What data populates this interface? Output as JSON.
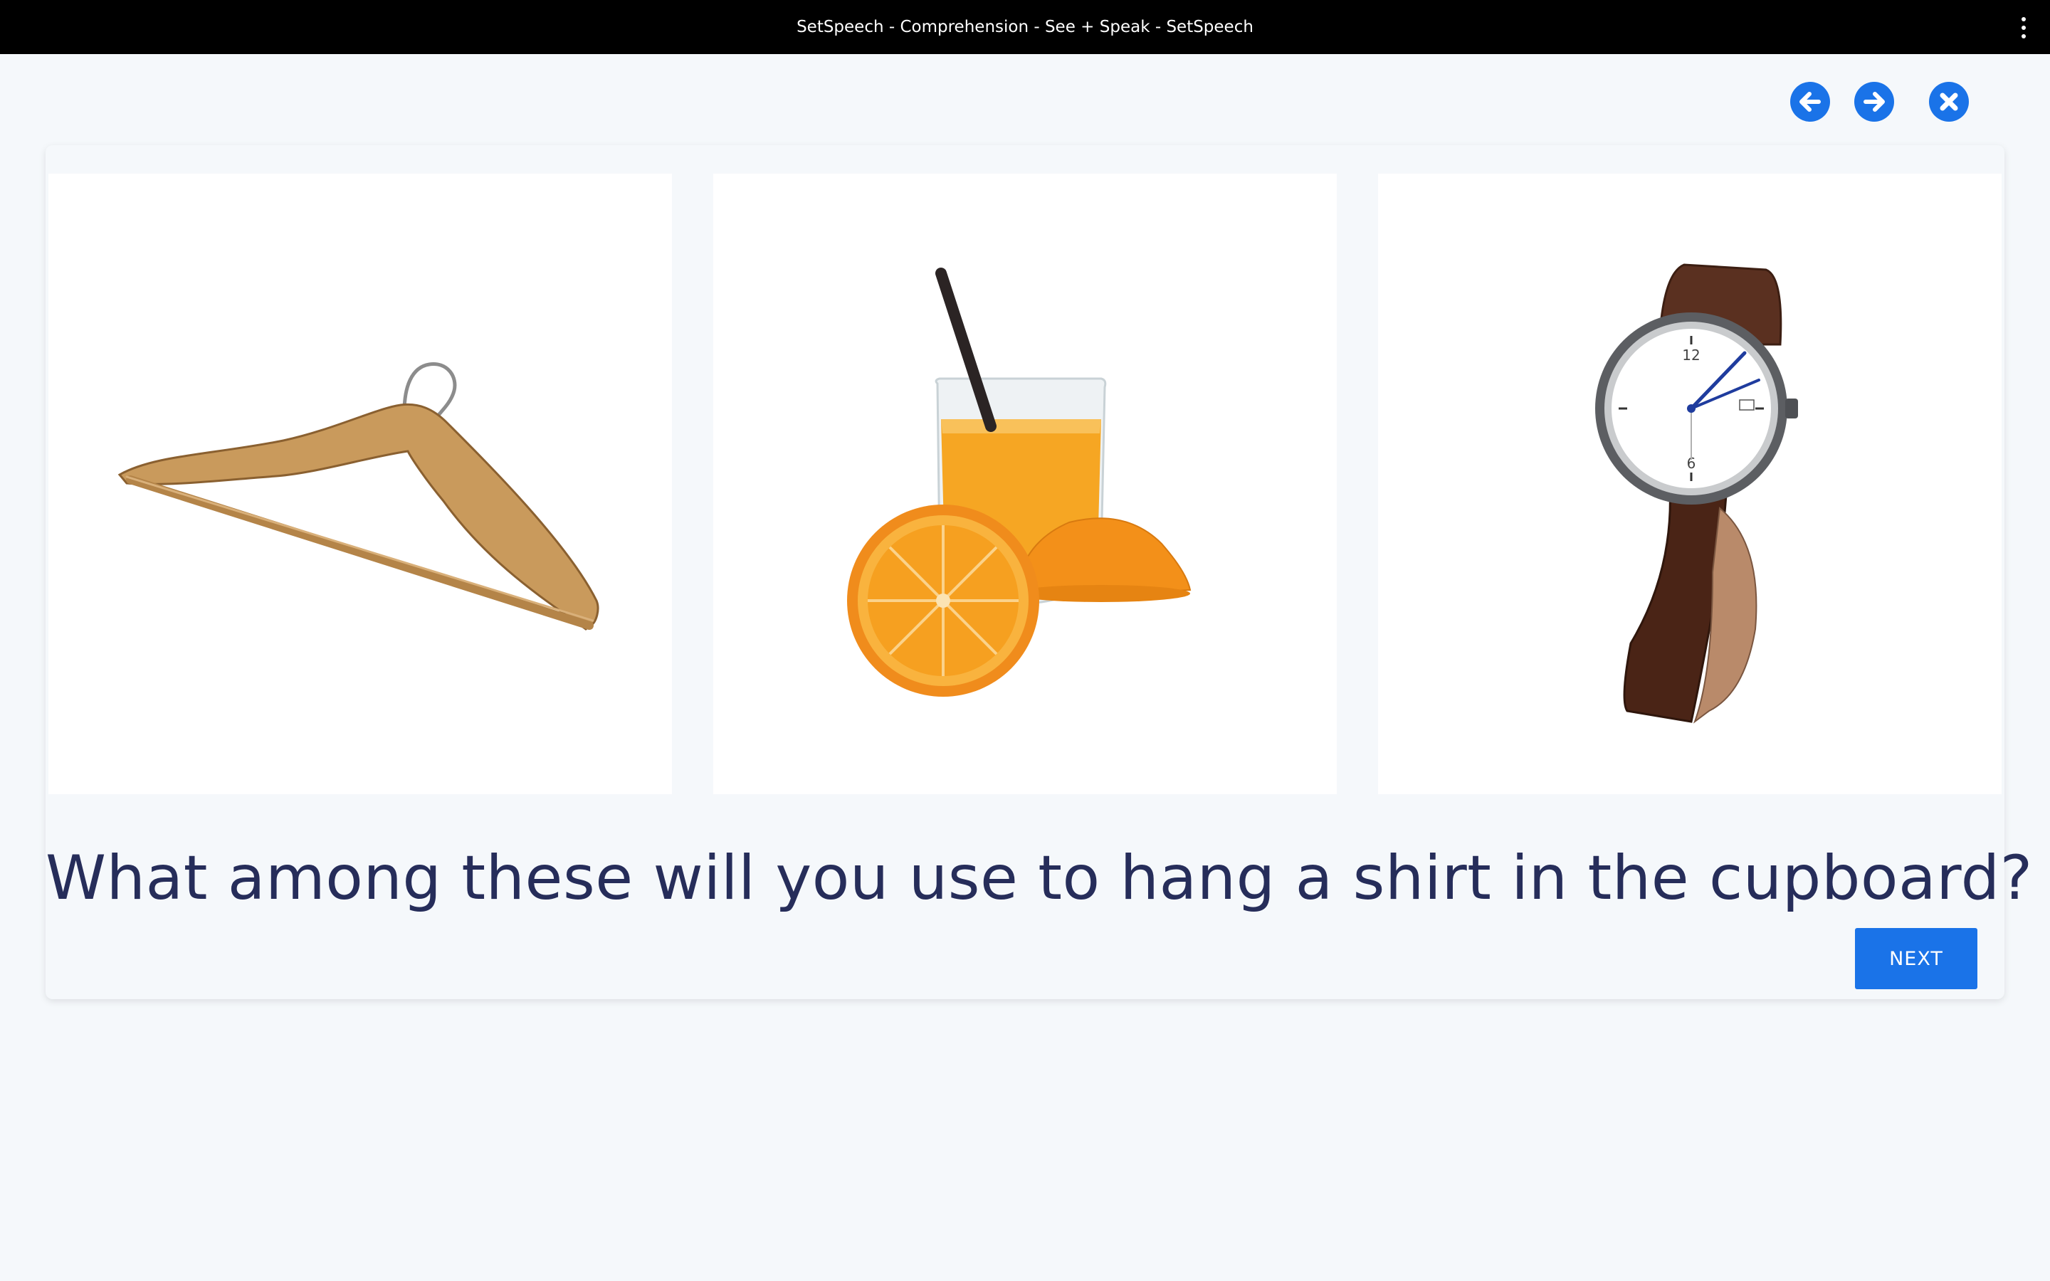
{
  "window": {
    "title": "SetSpeech - Comprehension - See + Speak - SetSpeech"
  },
  "icons": {
    "prev": "arrow-left-icon",
    "next": "arrow-right-icon",
    "close": "close-icon",
    "menu": "kebab-menu-icon"
  },
  "options": [
    {
      "name": "hanger-image"
    },
    {
      "name": "orange-juice-image"
    },
    {
      "name": "wristwatch-image"
    }
  ],
  "question": "What among these will you use to hang a shirt in the cupboard?",
  "next_label": "NEXT",
  "colors": {
    "accent": "#1a73e8",
    "question_text": "#262d5a",
    "background": "#f5f8fb",
    "titlebar": "#000000"
  }
}
